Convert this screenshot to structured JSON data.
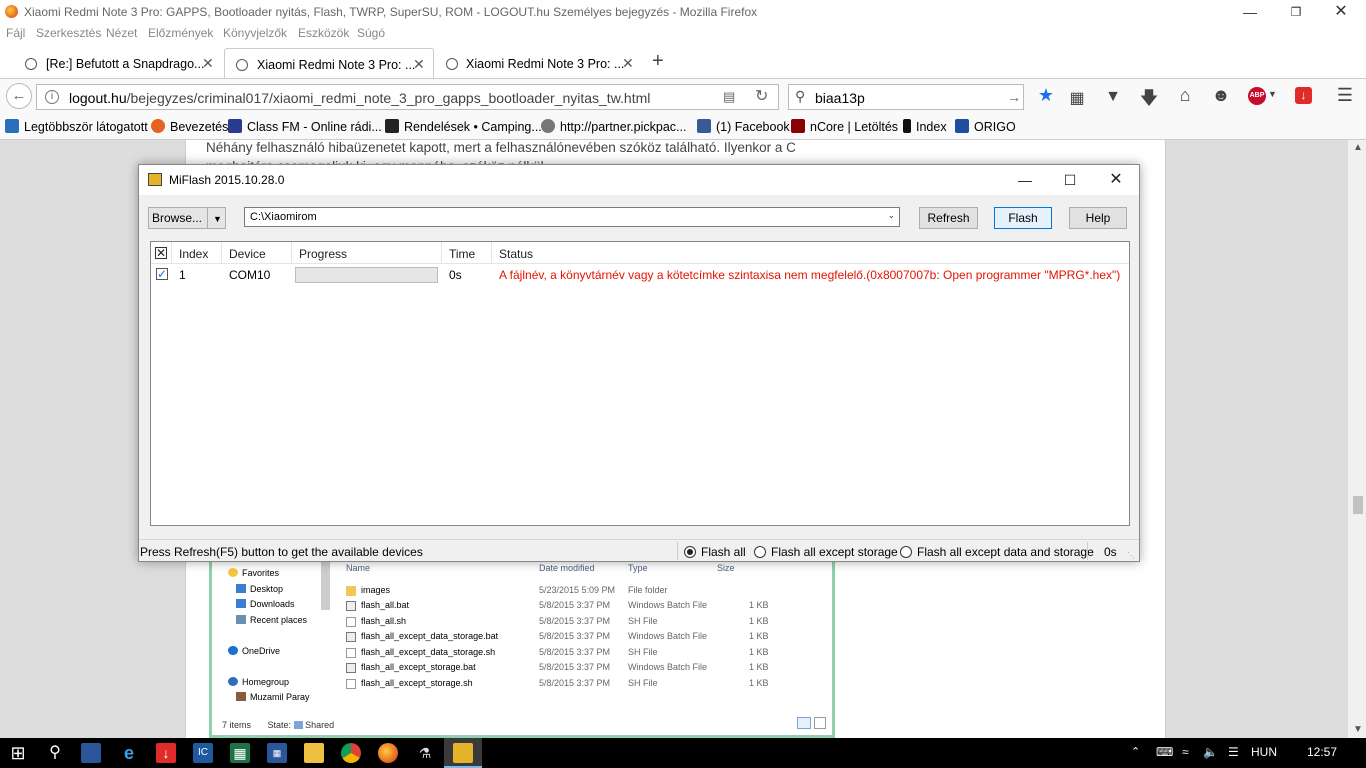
{
  "window": {
    "title": "Xiaomi Redmi Note 3 Pro: GAPPS, Bootloader nyitás, Flash, TWRP, SuperSU, ROM - LOGOUT.hu Személyes bejegyzés - Mozilla Firefox"
  },
  "menu": [
    "Fájl",
    "Szerkesztés",
    "Nézet",
    "Előzmények",
    "Könyvjelzők",
    "Eszközök",
    "Súgó"
  ],
  "tabs": [
    {
      "label": "[Re:] Befutott a Snapdrago..."
    },
    {
      "label": "Xiaomi Redmi Note 3 Pro: ..."
    },
    {
      "label": "Xiaomi Redmi Note 3 Pro: ..."
    }
  ],
  "nav": {
    "url_host": "logout.hu",
    "url_path": "/bejegyzes/criminal017/xiaomi_redmi_note_3_pro_gapps_bootloader_nyitas_tw.html",
    "search_value": "biaa13p"
  },
  "bookmarks": [
    {
      "label": "Legtöbbször látogatott",
      "color": "#2a6ebd"
    },
    {
      "label": "Bevezetés",
      "color": "#e5621f"
    },
    {
      "label": "Class FM - Online rádi...",
      "color": "#2a3b8f"
    },
    {
      "label": "Rendelések • Camping...",
      "color": "#222222"
    },
    {
      "label": "http://partner.pickpac...",
      "color": "#777777"
    },
    {
      "label": "(1) Facebook",
      "color": "#3b5998"
    },
    {
      "label": "nCore | Letöltés",
      "color": "#8b0000"
    },
    {
      "label": "Index",
      "color": "#111111"
    },
    {
      "label": "ORIGO",
      "color": "#1f4e9c"
    }
  ],
  "page_text": "Néhány felhasználó hibaüzenetet kapott, mert a felhasználónevében szóköz található. Ilyenkor a C meghajtóra csomagoljuk ki, egy mappába, szóköz nélkül.",
  "miflash": {
    "title": "MiFlash 2015.10.28.0",
    "browse_label": "Browse...",
    "path_value": "C:\\Xiaomirom",
    "refresh_label": "Refresh",
    "flash_label": "Flash",
    "help_label": "Help",
    "columns": {
      "index": "Index",
      "device": "Device",
      "progress": "Progress",
      "time": "Time",
      "status": "Status"
    },
    "rows": [
      {
        "index": "1",
        "device": "COM10",
        "progress": 0,
        "time": "0s",
        "status": "A fájlnév, a könyvtárnév vagy a kötetcímke szintaxisa nem megfelelő.(0x8007007b: Open programmer \"MPRG*.hex\")"
      }
    ],
    "status_hint": "Press Refresh(F5) button to get the available devices",
    "options": {
      "flash_all": "Flash all",
      "flash_all_except_storage": "Flash all except storage",
      "flash_all_except_data_storage": "Flash all except data and storage"
    },
    "selected_option": "flash_all",
    "elapsed": "0s",
    "error_color": "#e51400"
  },
  "explorer": {
    "headers": {
      "name": "Name",
      "date": "Date modified",
      "type": "Type",
      "size": "Size"
    },
    "nav": {
      "favorites": "Favorites",
      "desktop": "Desktop",
      "downloads": "Downloads",
      "recent": "Recent places",
      "onedrive": "OneDrive",
      "homegroup": "Homegroup",
      "user": "Muzamil Paray"
    },
    "files": [
      {
        "name": "images",
        "date": "5/23/2015 5:09 PM",
        "type": "File folder",
        "size": ""
      },
      {
        "name": "flash_all.bat",
        "date": "5/8/2015 3:37 PM",
        "type": "Windows Batch File",
        "size": "1 KB"
      },
      {
        "name": "flash_all.sh",
        "date": "5/8/2015 3:37 PM",
        "type": "SH File",
        "size": "1 KB"
      },
      {
        "name": "flash_all_except_data_storage.bat",
        "date": "5/8/2015 3:37 PM",
        "type": "Windows Batch File",
        "size": "1 KB"
      },
      {
        "name": "flash_all_except_data_storage.sh",
        "date": "5/8/2015 3:37 PM",
        "type": "SH File",
        "size": "1 KB"
      },
      {
        "name": "flash_all_except_storage.bat",
        "date": "5/8/2015 3:37 PM",
        "type": "Windows Batch File",
        "size": "1 KB"
      },
      {
        "name": "flash_all_except_storage.sh",
        "date": "5/8/2015 3:37 PM",
        "type": "SH File",
        "size": "1 KB"
      }
    ],
    "item_count": "7 items",
    "state": "State:",
    "state_value": "Shared"
  },
  "taskbar": {
    "lang": "HUN",
    "time": "12:57"
  }
}
